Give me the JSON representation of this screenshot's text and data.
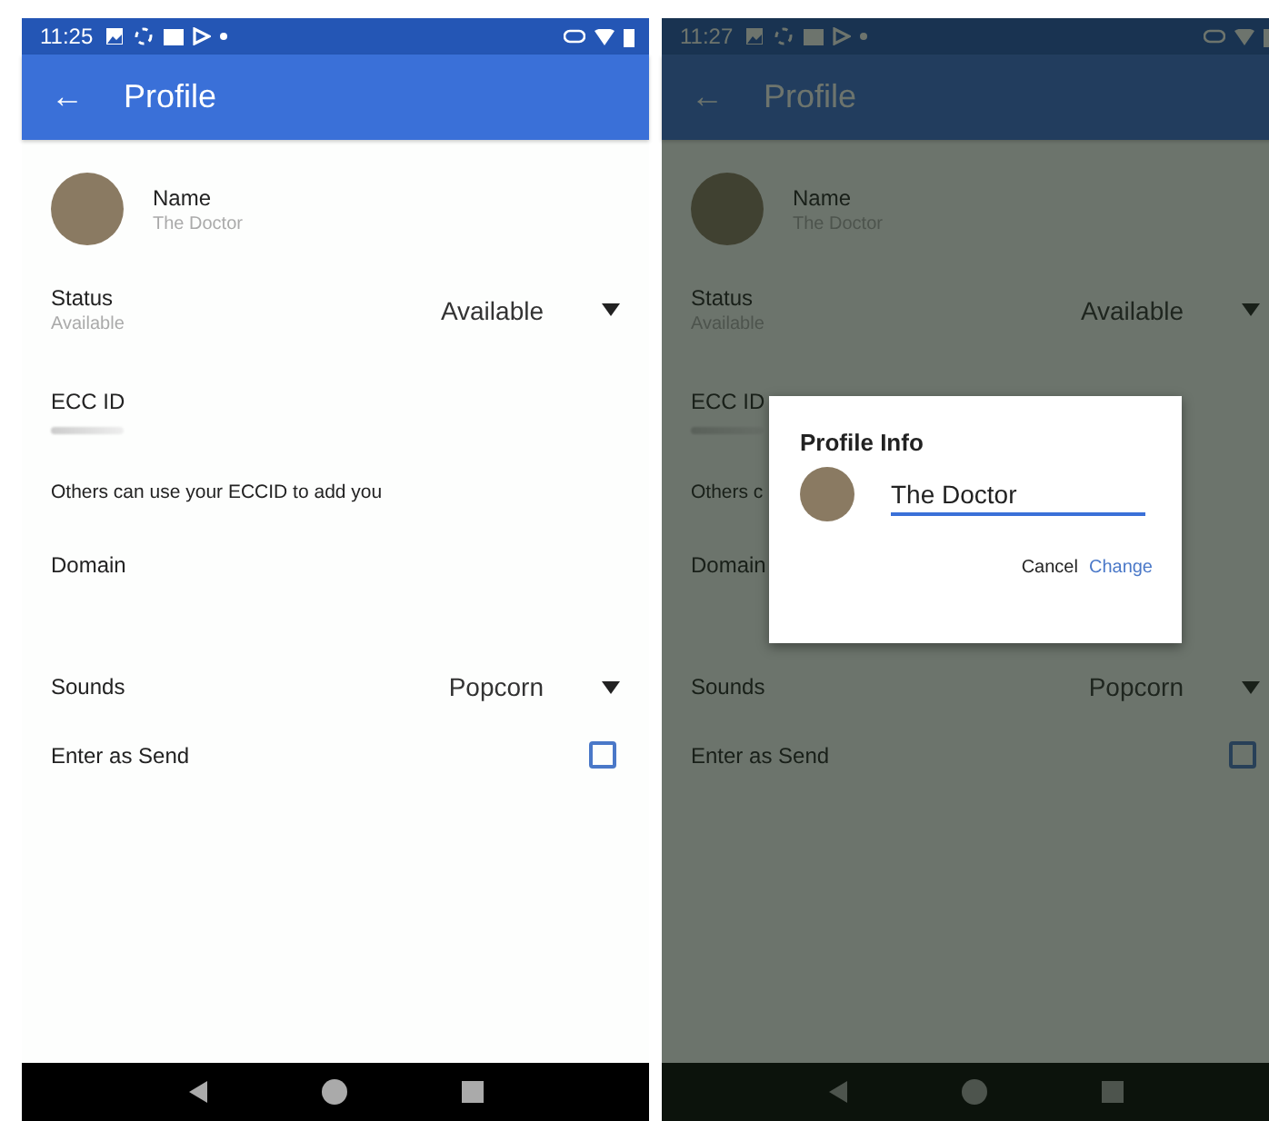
{
  "screens": [
    {
      "status_bar": {
        "time": "11:25"
      },
      "app_bar": {
        "title": "Profile",
        "back": "←"
      },
      "profile": {
        "name_label": "Name",
        "name_value": "The Doctor",
        "status_label": "Status",
        "status_value": "Available",
        "status_choice": "Available",
        "ecc_label": "ECC ID",
        "ecc_hint": "Others can use your ECCID to add you",
        "domain_label": "Domain",
        "sounds_label": "Sounds",
        "sounds_choice": "Popcorn",
        "enter_label": "Enter as Send",
        "enter_checked": false
      }
    },
    {
      "status_bar": {
        "time": "11:27"
      },
      "app_bar": {
        "title": "Profile",
        "back": "←"
      },
      "profile": {
        "name_label": "Name",
        "name_value": "The Doctor",
        "status_label": "Status",
        "status_value": "Available",
        "status_choice": "Available",
        "ecc_label": "ECC ID",
        "ecc_hint": "Others c",
        "domain_label": "Domain",
        "sounds_label": "Sounds",
        "sounds_choice": "Popcorn",
        "enter_label": "Enter as Send",
        "enter_checked": false
      },
      "dialog": {
        "title": "Profile Info",
        "value": "The Doctor",
        "buttons": [
          "Cancel",
          "Change"
        ]
      }
    }
  ]
}
